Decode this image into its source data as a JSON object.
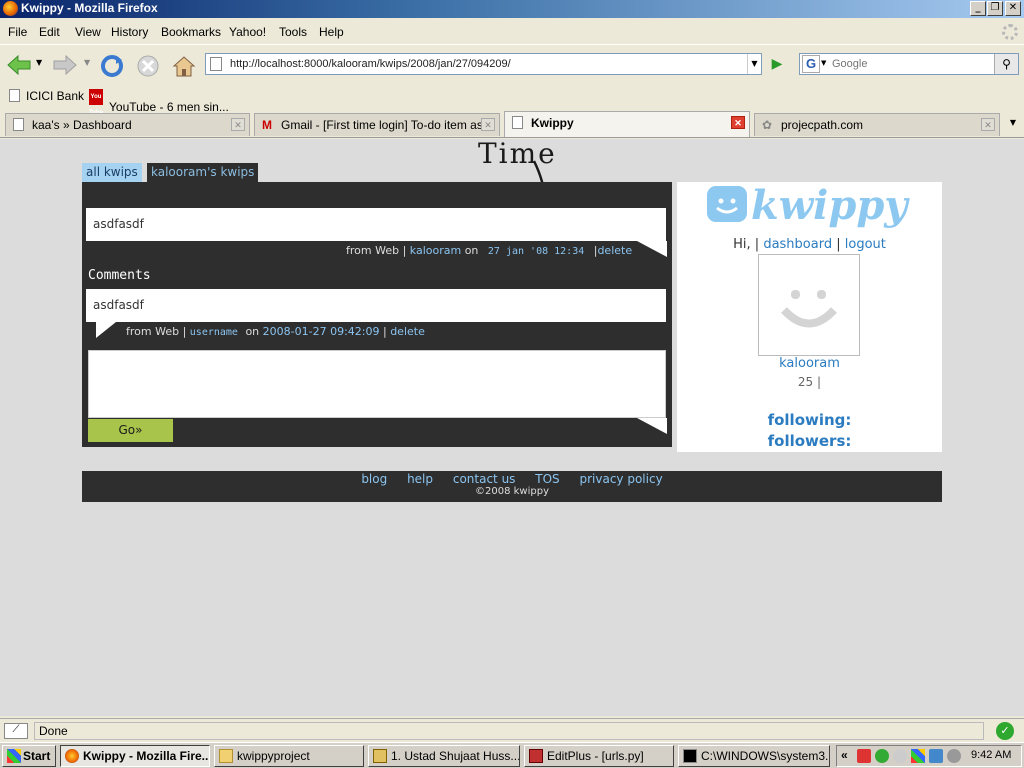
{
  "window": {
    "title": "Kwippy - Mozilla Firefox"
  },
  "menu": [
    "File",
    "Edit",
    "View",
    "History",
    "Bookmarks",
    "Yahoo!",
    "Tools",
    "Help"
  ],
  "nav": {
    "url": "http://localhost:8000/kalooram/kwips/2008/jan/27/094209/",
    "search_engine": "G",
    "search_placeholder": "Google"
  },
  "bookmarks": [
    "ICICI Bank",
    "YouTube - 6 men sin..."
  ],
  "tabs": [
    {
      "label": "kaa's » Dashboard"
    },
    {
      "label": "Gmail - [First time login] To-do item as..."
    },
    {
      "label": "Kwippy",
      "active": true
    },
    {
      "label": "projecpath.com"
    }
  ],
  "annotation": "Time",
  "page": {
    "tabs": {
      "all": "all kwips",
      "user": "kalooram's kwips"
    },
    "kwip": {
      "text": "asdfasdf",
      "from": "from Web |",
      "user": "kalooram",
      "on": "on",
      "time": "27 jan '08 12:34",
      "sep": "|",
      "delete": "delete"
    },
    "comments_heading": "Comments",
    "comment": {
      "text": "asdfasdf",
      "from": "from Web |",
      "user": "username",
      "on": "on",
      "time": "2008-01-27 09:42:09",
      "sep": "|",
      "delete": "delete"
    },
    "reply_value": "",
    "go_label": "Go»",
    "sidebar": {
      "logo_text": "kwippy",
      "hi": "Hi,",
      "sep1": "|",
      "dashboard": "dashboard",
      "sep2": "|",
      "logout": "logout",
      "username": "kalooram",
      "count": "25 |",
      "following": "following:",
      "followers": "followers:"
    },
    "footer": {
      "links": [
        "blog",
        "help",
        "contact us",
        "TOS",
        "privacy policy"
      ],
      "copyright": "©2008 kwippy"
    }
  },
  "status": {
    "text": "Done"
  },
  "taskbar": {
    "start": "Start",
    "items": [
      {
        "label": "Kwippy - Mozilla Fire...",
        "pressed": true
      },
      {
        "label": "kwippyproject"
      },
      {
        "label": "1. Ustad Shujaat Huss..."
      },
      {
        "label": "EditPlus - [urls.py]"
      },
      {
        "label": "C:\\WINDOWS\\system3..."
      }
    ],
    "tray_chevron": "«",
    "clock": "9:42 AM"
  }
}
